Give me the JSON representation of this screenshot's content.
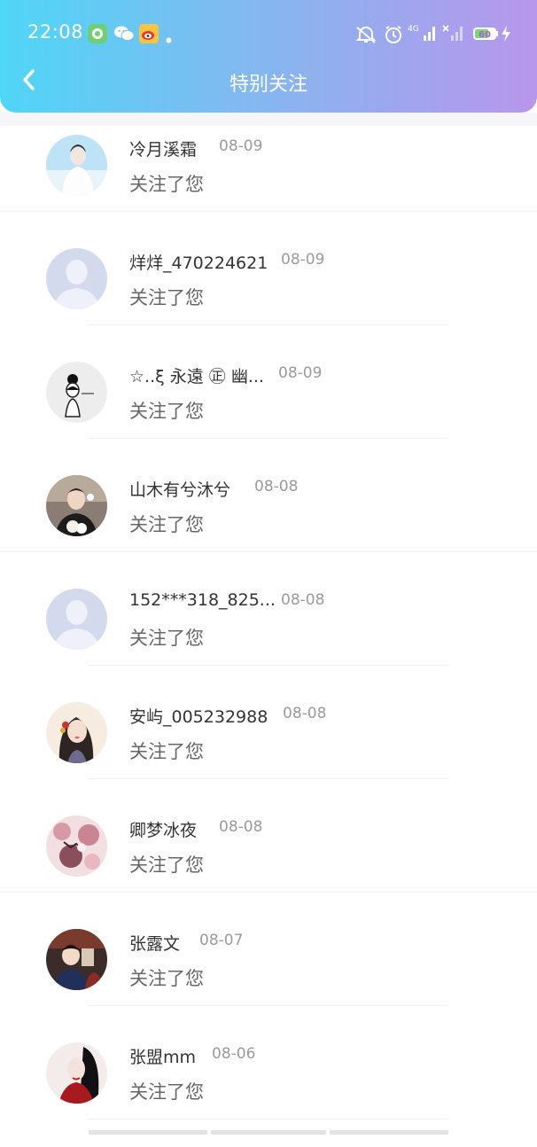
{
  "status_bar": {
    "time": "22:08",
    "network": "4G",
    "battery": "60",
    "icons": [
      "green-app-icon",
      "wechat-icon",
      "weibo-icon",
      "dot-icon",
      "mute-icon",
      "alarm-icon",
      "signal-4g-icon",
      "signal-no-service-icon",
      "battery-icon",
      "charging-icon"
    ]
  },
  "header": {
    "title": "特别关注",
    "back_icon": "chevron-left-icon"
  },
  "follows": [
    {
      "name": "冷月溪霜",
      "date": "08-09",
      "message": "关注了您",
      "avatar": "photo-white-outfit"
    },
    {
      "name": "烊烊_470224621",
      "date": "08-09",
      "message": "关注了您",
      "avatar": "default-person"
    },
    {
      "name": "☆..ξ 永遠 ㊣ 幽...",
      "date": "08-09",
      "message": "关注了您",
      "avatar": "sketch-girl"
    },
    {
      "name": "山木有兮沐兮",
      "date": "08-08",
      "message": "关注了您",
      "avatar": "photo-boy-flowers"
    },
    {
      "name": "152***318_825...",
      "date": "08-08",
      "message": "关注了您",
      "avatar": "default-person"
    },
    {
      "name": "安屿_005232988",
      "date": "08-08",
      "message": "关注了您",
      "avatar": "illustrated-girl"
    },
    {
      "name": "卿梦冰夜",
      "date": "08-08",
      "message": "关注了您",
      "avatar": "pink-floral-art"
    },
    {
      "name": "张露文",
      "date": "08-07",
      "message": "关注了您",
      "avatar": "anime-detective"
    },
    {
      "name": "张盟mm",
      "date": "08-06",
      "message": "关注了您",
      "avatar": "photo-girl-red"
    }
  ],
  "colors": {
    "header_start": "#4fd6f7",
    "header_end": "#b896ec",
    "message": "#666666",
    "date": "#9a9a9a"
  }
}
